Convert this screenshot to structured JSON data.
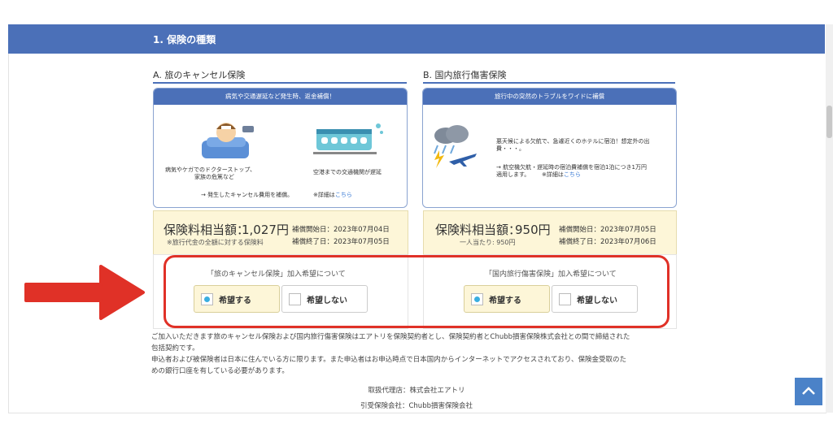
{
  "section": {
    "title": "1. 保険の種類"
  },
  "plans": [
    {
      "label": "A. 旅のキャンセル保険",
      "banner": "病気や交通遅延など発生時、返金補償！",
      "caption_left_1": "病気やケガでのドクターストップ、",
      "caption_left_2": "家族の危篤など",
      "caption_right": "空港までの交通機関が遅延",
      "note": "→ 発生したキャンセル費用を補償。",
      "detail_prefix": "※詳細は",
      "detail_link": "こちら",
      "premium_label": "保険料相当額：",
      "premium_value": "1,027円",
      "premium_sub": "※旅行代金の全額に対する保険料",
      "start_label": "補償開始日：",
      "start_date": "2023年07月04日",
      "end_label": "補償終了日：",
      "end_date": "2023年07月05日",
      "choice_title": "「旅のキャンセル保険」加入希望について",
      "yes": "希望する",
      "no": "希望しない"
    },
    {
      "label": "B. 国内旅行傷害保険",
      "banner": "旅行中の突然のトラブルをワイドに補償",
      "desc_1": "悪天候による欠航で、急遽近くのホテルに宿泊！想定外の出",
      "desc_2": "費・・・。",
      "desc_3": "→ 航空機欠航・遅延時の宿泊費補償を宿泊1泊につき1万円",
      "desc_4": "適用します。",
      "detail_prefix": "※詳細は",
      "detail_link": "こちら",
      "premium_label": "保険料相当額：",
      "premium_value": "950円",
      "premium_sub": "一人当たり: 950円",
      "start_label": "補償開始日：",
      "start_date": "2023年07月05日",
      "end_label": "補償終了日：",
      "end_date": "2023年07月06日",
      "choice_title": "「国内旅行傷害保険」加入希望について",
      "yes": "希望する",
      "no": "希望しない"
    }
  ],
  "notes": {
    "line1": "ご加入いただきます旅のキャンセル保険および国内旅行傷害保険はエアトリを保険契約者とし、保険契約者とChubb損害保険株式会社との間で締結された",
    "line2": "包括契約です。",
    "line3": "申込者および被保険者は日本に住んでいる方に限ります。また申込者はお申込時点で日本国内からインターネットでアクセスされており、保険金受取のた",
    "line4": "めの銀行口座を有している必要があります。",
    "agent": "取扱代理店：株式会社エアトリ",
    "insurer": "引受保険会社：Chubb損害保険会社"
  },
  "colors": {
    "header": "#4b70b8",
    "highlight": "#e03127",
    "premium_bg": "#fdf6d8",
    "radio_dot": "#3aaee0"
  }
}
